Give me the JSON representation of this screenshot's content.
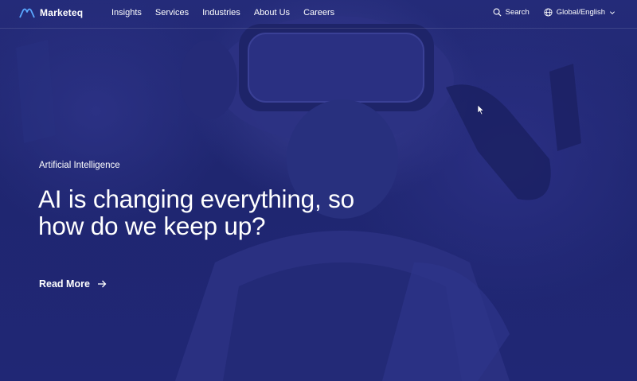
{
  "brand": {
    "name": "Marketeq"
  },
  "nav": {
    "items": [
      {
        "label": "Insights"
      },
      {
        "label": "Services"
      },
      {
        "label": "Industries"
      },
      {
        "label": "About Us"
      },
      {
        "label": "Careers"
      }
    ],
    "search_label": "Search",
    "locale_label": "Global/English"
  },
  "hero": {
    "eyebrow": "Artificial Intelligence",
    "headline": "AI is changing everything, so how do we keep up?",
    "cta_label": "Read More"
  },
  "colors": {
    "overlay": "#1f2670",
    "text": "#ffffff"
  },
  "icons": [
    "marketeq-logo-icon",
    "search-icon",
    "globe-icon",
    "chevron-down-icon",
    "arrow-right-icon",
    "mouse-cursor-icon"
  ]
}
